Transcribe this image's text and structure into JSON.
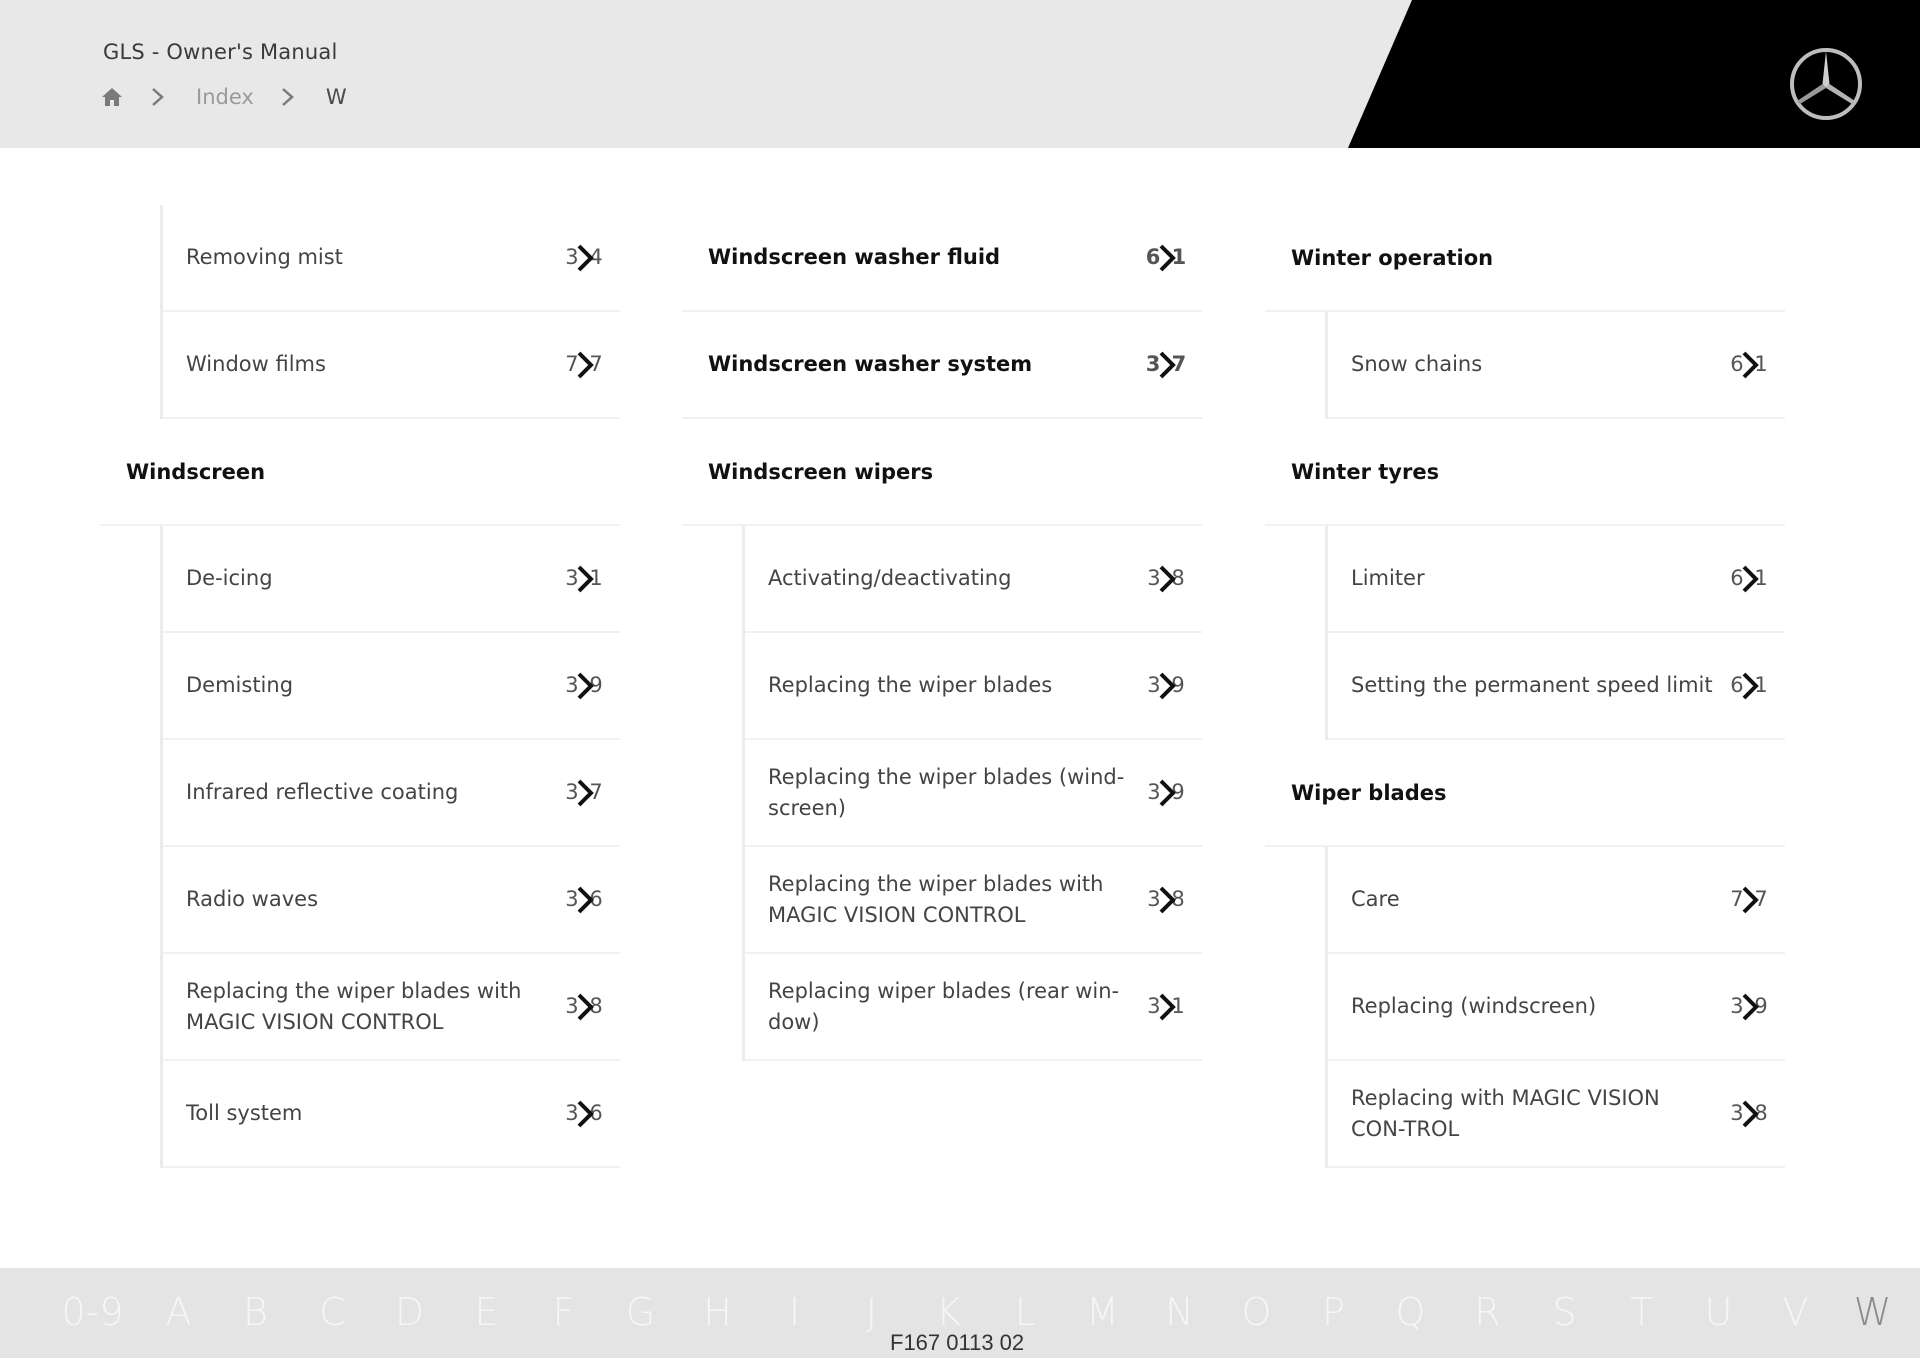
{
  "header": {
    "title": "GLS - Owner's Manual",
    "breadcrumb": {
      "home_icon": "home-icon",
      "separator_icon": "chevron-right-icon",
      "items": [
        "Index",
        "W"
      ]
    },
    "brand_logo": "mercedes-star-logo"
  },
  "columns": [
    {
      "groups": [
        {
          "heading": null,
          "items": [
            {
              "label": "Removing mist",
              "page_visible": "3 4"
            },
            {
              "label": "Window films",
              "page_visible": "7 7"
            }
          ]
        },
        {
          "heading": "Windscreen",
          "items": [
            {
              "label": "De-icing",
              "page_visible": "3 1"
            },
            {
              "label": "Demisting",
              "page_visible": "3 9"
            },
            {
              "label": "Infrared reflective coating",
              "page_visible": "3 7"
            },
            {
              "label": "Radio waves",
              "page_visible": "3 6"
            },
            {
              "label": "Replacing the wiper blades with MAGIC VISION CONTROL",
              "page_visible": "3 8"
            },
            {
              "label": "Toll system",
              "page_visible": "3 6"
            }
          ]
        }
      ]
    },
    {
      "groups": [
        {
          "heading": null,
          "bold_items": [
            {
              "label": "Windscreen washer fluid",
              "page_visible": "6 1"
            },
            {
              "label": "Windscreen washer system",
              "page_visible": "3 7"
            }
          ]
        },
        {
          "heading": "Windscreen wipers",
          "items": [
            {
              "label": "Activating/deactivating",
              "page_visible": "3 8"
            },
            {
              "label": "Replacing the wiper blades",
              "page_visible": "3 9"
            },
            {
              "label": "Replacing the wiper blades (wind-screen)",
              "page_visible": "3 9"
            },
            {
              "label": "Replacing the wiper blades with MAGIC VISION CONTROL",
              "page_visible": "3 8"
            },
            {
              "label": "Replacing wiper blades (rear win-dow)",
              "page_visible": "3 1"
            }
          ]
        }
      ]
    },
    {
      "groups": [
        {
          "heading": "Winter operation",
          "items": [
            {
              "label": "Snow chains",
              "page_visible": "6 1"
            }
          ]
        },
        {
          "heading": "Winter tyres",
          "items": [
            {
              "label": "Limiter",
              "page_visible": "6 1"
            },
            {
              "label": "Setting the permanent speed limit",
              "page_visible": "6 1"
            }
          ]
        },
        {
          "heading": "Wiper blades",
          "items": [
            {
              "label": "Care",
              "page_visible": "7 7"
            },
            {
              "label": "Replacing (windscreen)",
              "page_visible": "3 9"
            },
            {
              "label": "Replacing with MAGIC VISION CON-TROL",
              "page_visible": "3 8"
            }
          ]
        }
      ]
    }
  ],
  "footer": {
    "alphabet": [
      "0-9",
      "A",
      "B",
      "C",
      "D",
      "E",
      "F",
      "G",
      "H",
      "I",
      "J",
      "K",
      "L",
      "M",
      "N",
      "O",
      "P",
      "Q",
      "R",
      "S",
      "T",
      "U",
      "V",
      "W"
    ],
    "active_letter": "W",
    "doc_id": "F167 0113 02"
  },
  "colors": {
    "header_bg": "#e8e8e8",
    "brand_black": "#000000",
    "footer_bg": "#e4e4e4",
    "active_letter": "#8a8a8a"
  }
}
